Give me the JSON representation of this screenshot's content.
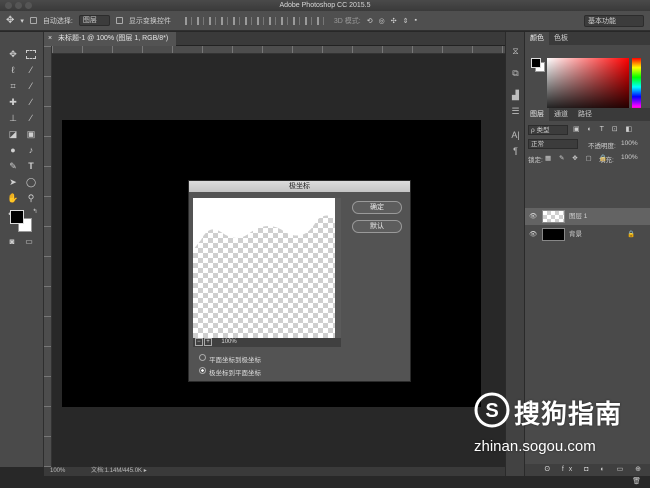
{
  "app": {
    "title": "Adobe Photoshop CC 2015.5"
  },
  "options_bar": {
    "auto_select_label": "自动选择:",
    "auto_select_value": "图层",
    "show_transform_label": "显示变换控件",
    "mode_3d_label": "3D 模式:",
    "workspace": "基本功能"
  },
  "document": {
    "tab_title": "未标题-1 @ 100% (图层 1, RGB/8*)",
    "tab_close": "×"
  },
  "status_bar": {
    "zoom": "100%",
    "doc_size": "文档:1.14M/445.0K"
  },
  "panels": {
    "color_tabs": [
      "颜色",
      "色板"
    ],
    "layers_tabs": [
      "图层",
      "通道",
      "路径"
    ],
    "kind_filter": "ρ 类型",
    "blend_mode": "正常",
    "opacity_label": "不透明度:",
    "opacity_value": "100%",
    "lock_label": "锁定:",
    "fill_label": "填充:",
    "fill_value": "100%",
    "layers": [
      {
        "name": "图层 1",
        "thumb": "transparent",
        "selected": true
      },
      {
        "name": "背景",
        "thumb": "black",
        "selected": false
      }
    ]
  },
  "dialog": {
    "title": "极坐标",
    "ok_label": "确定",
    "default_label": "默认",
    "zoom_value": "100%",
    "options": [
      {
        "label": "平面坐标到极坐标",
        "selected": false
      },
      {
        "label": "极坐标到平面坐标",
        "selected": true
      }
    ]
  },
  "watermark": {
    "brand_cn": "搜狗指南",
    "url": "zhinan.sogou.com"
  },
  "icons": [
    "move-icon",
    "marquee-icon",
    "lasso-icon",
    "magic-wand-icon",
    "crop-icon",
    "eyedropper-icon",
    "healing-icon",
    "brush-icon",
    "stamp-icon",
    "history-brush-icon",
    "eraser-icon",
    "gradient-icon",
    "blur-icon",
    "dodge-icon",
    "pen-icon",
    "type-icon",
    "path-select-icon",
    "shape-icon",
    "hand-icon",
    "zoom-icon"
  ],
  "colors": {
    "ui_dark": "#282828",
    "panel": "#4a4a4a",
    "canvas": "#000000",
    "accent_red": "#ff0000"
  }
}
